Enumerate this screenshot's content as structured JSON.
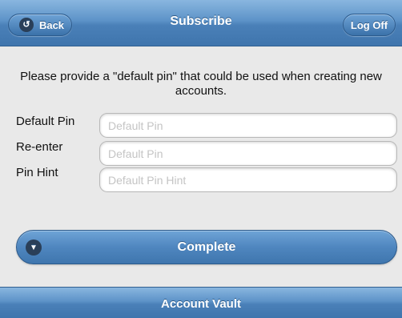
{
  "header": {
    "title": "Subscribe",
    "back_label": "Back",
    "back_icon": "back-arrow-icon",
    "logoff_label": "Log Off"
  },
  "form": {
    "intro": "Please provide a \"default pin\" that could be used when creating new accounts.",
    "fields": [
      {
        "label": "Default Pin",
        "placeholder": "Default Pin",
        "value": ""
      },
      {
        "label": "Re-enter",
        "placeholder": "Default Pin",
        "value": ""
      },
      {
        "label": "Pin Hint",
        "placeholder": "Default Pin Hint",
        "value": ""
      }
    ],
    "complete_label": "Complete",
    "complete_icon": "chevron-down-icon"
  },
  "footer": {
    "title": "Account Vault"
  },
  "colors": {
    "bar_blue": "#4a80b8",
    "background": "#e9e9e9",
    "icon_dark": "#2a3f58"
  }
}
